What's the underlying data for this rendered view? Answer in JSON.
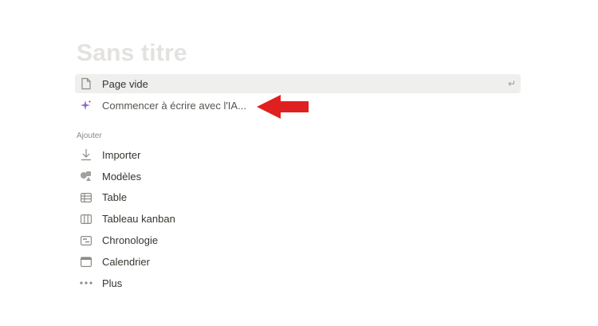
{
  "page": {
    "title": "Sans titre"
  },
  "top_options": [
    {
      "label": "Page vide",
      "icon": "page-icon",
      "hint": "↵"
    },
    {
      "label": "Commencer à écrire avec l'IA...",
      "icon": "sparkle-icon"
    }
  ],
  "add_section": {
    "label": "Ajouter",
    "items": [
      {
        "label": "Importer",
        "icon": "download-icon"
      },
      {
        "label": "Modèles",
        "icon": "templates-icon"
      },
      {
        "label": "Table",
        "icon": "table-icon"
      },
      {
        "label": "Tableau kanban",
        "icon": "board-icon"
      },
      {
        "label": "Chronologie",
        "icon": "timeline-icon"
      },
      {
        "label": "Calendrier",
        "icon": "calendar-icon"
      },
      {
        "label": "Plus",
        "icon": "more-icon"
      }
    ]
  },
  "annotation": {
    "arrow_color": "#e02020",
    "icon": "red-arrow-icon"
  }
}
